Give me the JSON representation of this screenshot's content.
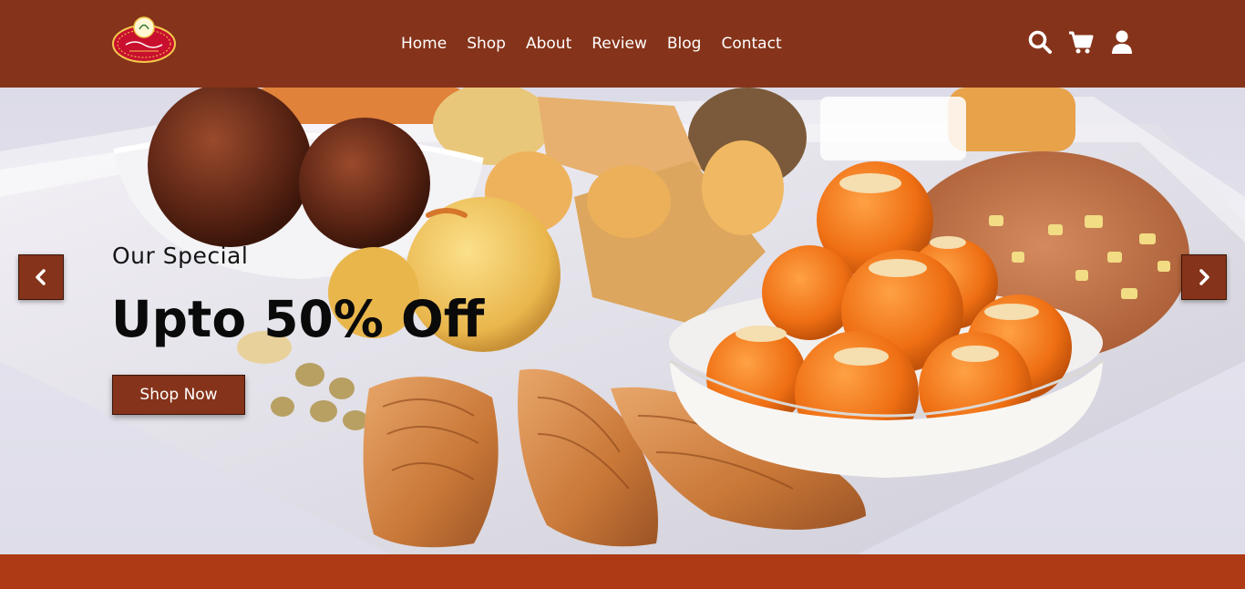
{
  "brand": {
    "logo_icon": "sweets-brand-logo-icon",
    "colors": {
      "primary": "#85331a",
      "strip": "#ad3a14",
      "text_light": "#ffffff"
    }
  },
  "nav": {
    "items": [
      {
        "label": "Home"
      },
      {
        "label": "Shop"
      },
      {
        "label": "About"
      },
      {
        "label": "Review"
      },
      {
        "label": "Blog"
      },
      {
        "label": "Contact"
      }
    ]
  },
  "header_icons": [
    "search-icon",
    "cart-icon",
    "user-icon"
  ],
  "hero": {
    "subtitle": "Our Special",
    "title": "Upto 50% Off",
    "button_label": "Shop Now",
    "prev_icon": "chevron-left-icon",
    "next_icon": "chevron-right-icon"
  }
}
